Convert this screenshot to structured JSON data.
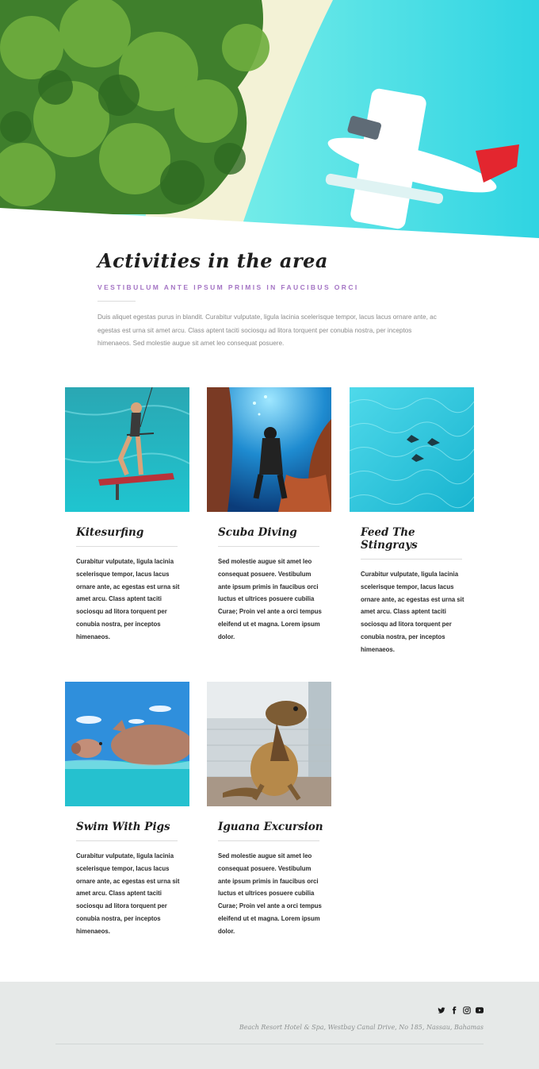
{
  "hero": {
    "image": "aerial beach with palm trees and seaplane"
  },
  "intro": {
    "title": "Activities in the area",
    "subtitle": "VESTIBULUM ANTE IPSUM PRIMIS IN FAUCIBUS ORCI",
    "body": "Duis aliquet egestas purus in blandit. Curabitur vulputate, ligula lacinia scelerisque tempor, lacus lacus ornare ante, ac egestas est urna sit amet arcu. Class aptent taciti sociosqu ad litora torquent per conubia nostra, per inceptos himenaeos. Sed molestie augue sit amet leo consequat posuere."
  },
  "activities": [
    {
      "title": "Kitesurfing",
      "image": "kitesurfer on turquoise water",
      "text": "Curabitur vulputate, ligula lacinia scelerisque tempor, lacus lacus ornare ante, ac egestas est urna sit amet arcu. Class aptent taciti sociosqu ad litora torquent per conubia nostra, per inceptos himenaeos."
    },
    {
      "title": "Scuba Diving",
      "image": "diver underwater",
      "text": "Sed molestie augue sit amet leo consequat posuere. Vestibulum ante ipsum primis in faucibus orci luctus et ultrices posuere cubilia Curae; Proin vel ante a orci tempus eleifend ut et magna. Lorem ipsum dolor."
    },
    {
      "title": "Feed The Stingrays",
      "image": "stingrays in clear water",
      "text": "Curabitur vulputate, ligula lacinia scelerisque tempor, lacus lacus ornare ante, ac egestas est urna sit amet arcu. Class aptent taciti sociosqu ad litora torquent per conubia nostra, per inceptos himenaeos."
    },
    {
      "title": "Swim With Pigs",
      "image": "pig swimming in the sea",
      "text": "Curabitur vulputate, ligula lacinia scelerisque tempor, lacus lacus ornare ante, ac egestas est urna sit amet arcu. Class aptent taciti sociosqu ad litora torquent per conubia nostra, per inceptos himenaeos."
    },
    {
      "title": "Iguana Excursion",
      "image": "iguana on wooden deck",
      "text": "Sed molestie augue sit amet leo consequat posuere. Vestibulum ante ipsum primis in faucibus orci luctus et ultrices posuere cubilia Curae; Proin vel ante a orci tempus eleifend ut et magna. Lorem ipsum dolor."
    }
  ],
  "footer": {
    "social": [
      "twitter-icon",
      "facebook-icon",
      "instagram-icon",
      "youtube-icon"
    ],
    "address": "Beach Resort Hotel & Spa, Westbay Canal Drive, No 185, Nassau, Bahamas"
  },
  "colors": {
    "accent": "#a474c4",
    "footer_bg": "#e6e9e8"
  }
}
